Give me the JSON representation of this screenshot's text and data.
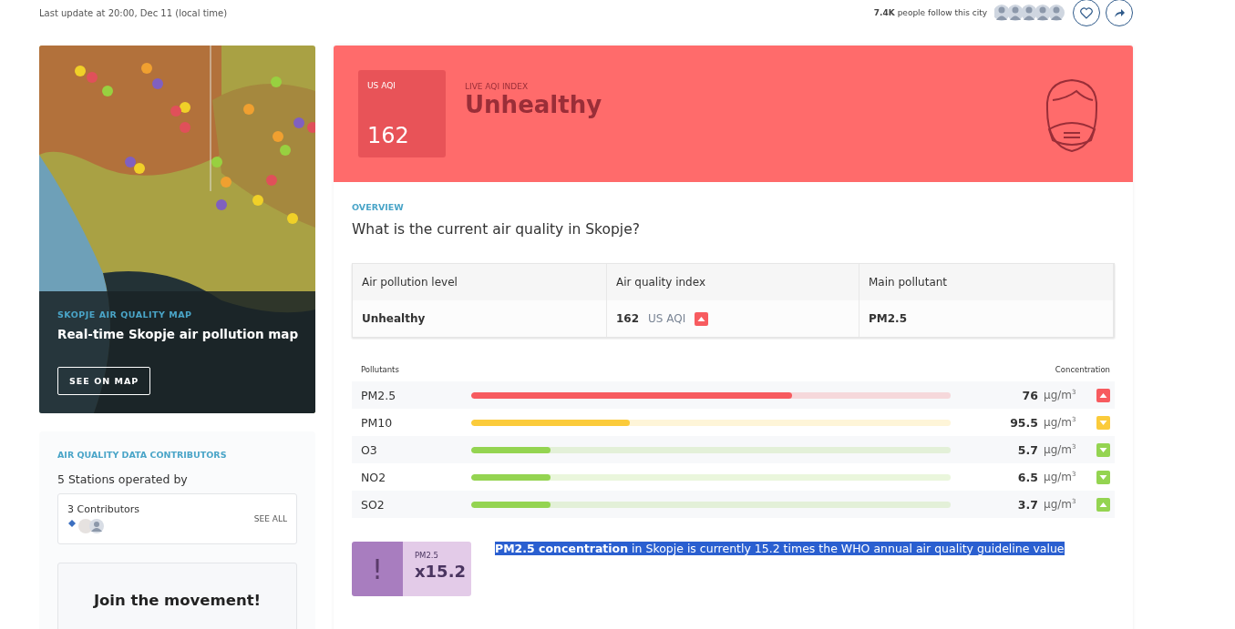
{
  "header": {
    "last_update": "Last update at 20:00, Dec 11 (local time)",
    "followers_count": "7.4K",
    "followers_text": "people follow this city"
  },
  "map_card": {
    "eyebrow": "SKOPJE AIR QUALITY MAP",
    "title": "Real-time Skopje air pollution map",
    "button": "SEE ON MAP"
  },
  "contributors_card": {
    "eyebrow": "AIR QUALITY DATA CONTRIBUTORS",
    "stations": "5 Stations operated by",
    "contributors": "3 Contributors",
    "see_all": "SEE ALL"
  },
  "join_card": {
    "title": "Join the movement!"
  },
  "aqi_banner": {
    "badge_label": "US AQI",
    "badge_value": "162",
    "eyebrow": "LIVE AQI INDEX",
    "status": "Unhealthy",
    "color": "#ff6b6b"
  },
  "overview": {
    "eyebrow": "OVERVIEW",
    "question": "What is the current air quality in Skopje?",
    "table": {
      "columns": [
        "Air pollution level",
        "Air quality index",
        "Main pollutant"
      ],
      "level": "Unhealthy",
      "aqi_value": "162",
      "aqi_unit": "US AQI",
      "aqi_rising": true,
      "pollutant": "PM2.5"
    }
  },
  "pollutants": {
    "header_left": "Pollutants",
    "header_right": "Concentration",
    "rows": [
      {
        "name": "PM2.5",
        "level": 0.67,
        "value": "76",
        "unit": "µg/m$^{3}$",
        "rising": true,
        "color": "#f75b5f"
      },
      {
        "name": "PM10",
        "level": 0.33,
        "value": "95.5",
        "unit": "µg/m$^{3}$",
        "rising": false,
        "color": "#fbcb3b"
      },
      {
        "name": "O3",
        "level": 0.165,
        "value": "5.7",
        "unit": "µg/m$^{3}$",
        "rising": false,
        "color": "#94d451"
      },
      {
        "name": "NO2",
        "level": 0.165,
        "value": "6.5",
        "unit": "µg/m$^{3}$",
        "rising": false,
        "color": "#94d451"
      },
      {
        "name": "SO2",
        "level": 0.165,
        "value": "3.7",
        "unit": "µg/m$^{3}$",
        "rising": true,
        "color": "#94d451"
      }
    ]
  },
  "who": {
    "mark": "!",
    "pollutant": "PM2.5",
    "factor": "x15.2",
    "sentence": "**PM2.5 concentration** in Skopje is currently 15.2 times the WHO annual air quality guideline value",
    "selected": true
  }
}
